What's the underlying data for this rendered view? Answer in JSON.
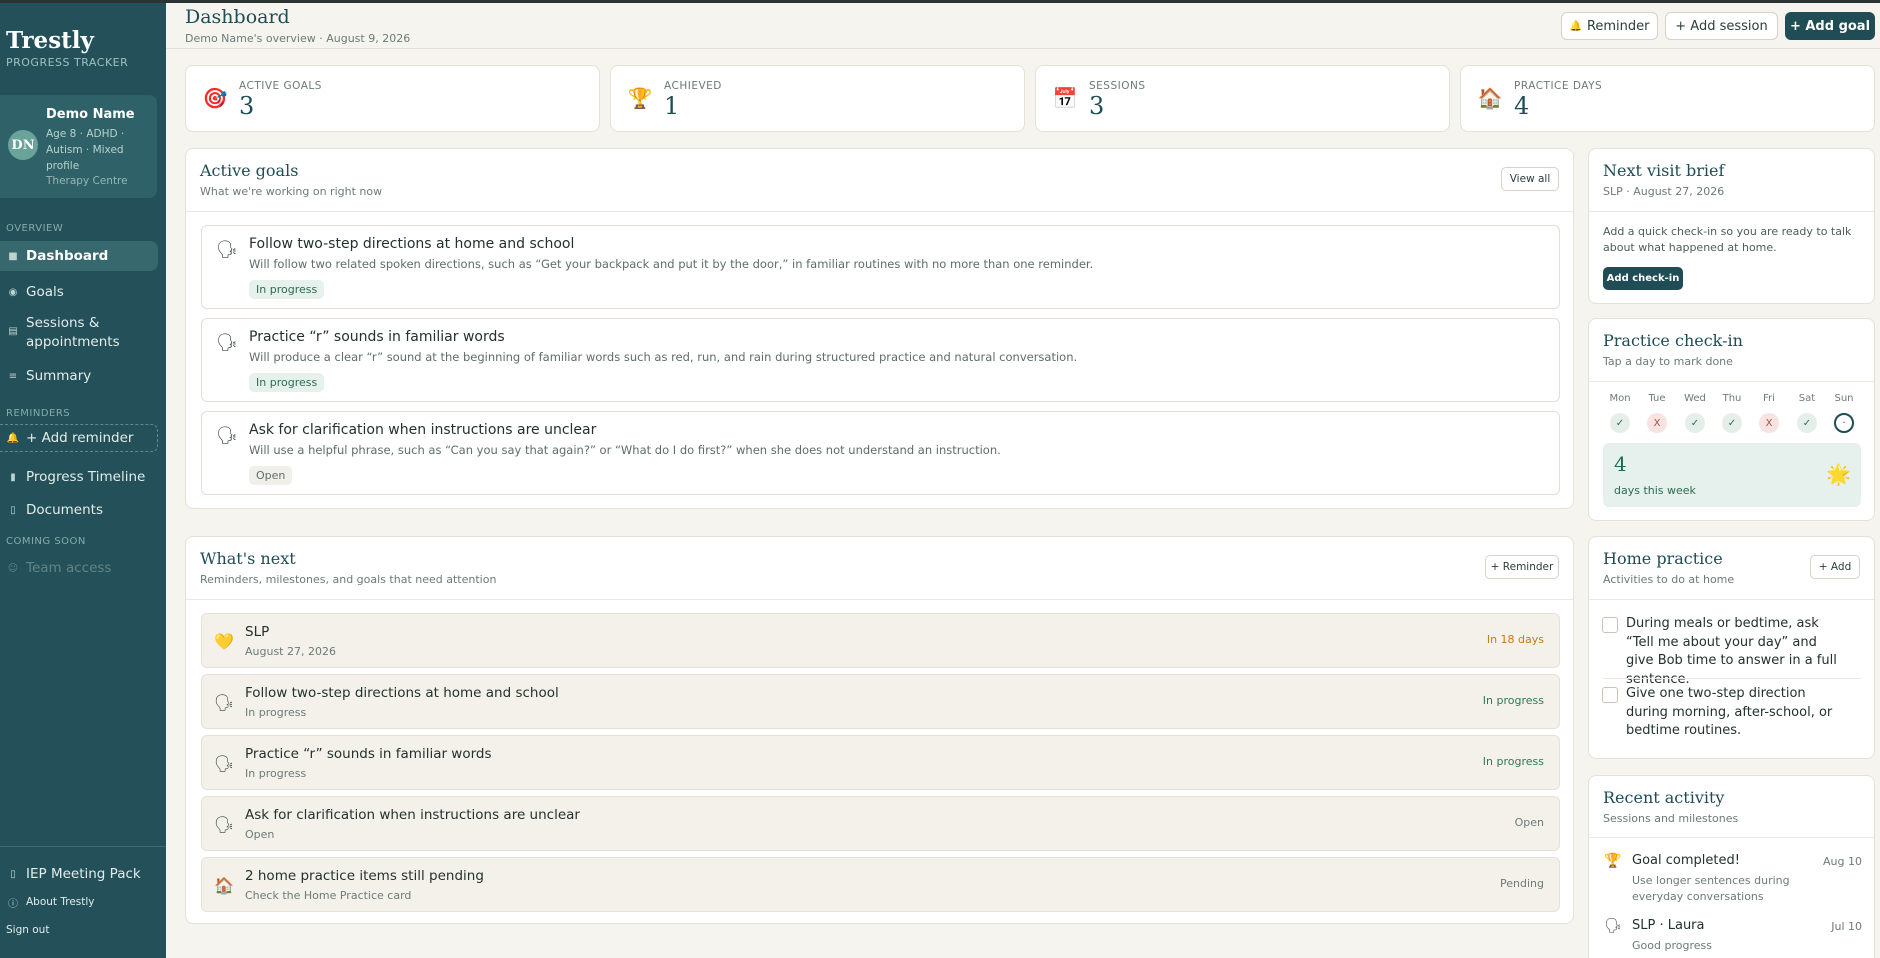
{
  "sidebar": {
    "brand": "Trestly",
    "brand_sub": "PROGRESS TRACKER",
    "profile": {
      "initials": "DN",
      "name": "Demo Name",
      "details": "Age 8 · ADHD · Autism · Mixed profile",
      "org": "Therapy Centre"
    },
    "overview_label": "OVERVIEW",
    "nav": [
      {
        "label": "Dashboard",
        "icon": "dashboard-icon"
      },
      {
        "label": "Goals",
        "icon": "target-icon"
      },
      {
        "label": "Sessions & appointments",
        "icon": "calendar-icon"
      },
      {
        "label": "Summary",
        "icon": "list-icon"
      }
    ],
    "reminders_label": "REMINDERS",
    "add_reminder": "+ Add reminder",
    "nav2": [
      {
        "label": "Progress Timeline",
        "icon": "chart-icon"
      },
      {
        "label": "Documents",
        "icon": "document-icon"
      }
    ],
    "coming_soon_label": "COMING SOON",
    "team_access": "Team access",
    "iep": "IEP Meeting Pack",
    "about": "About Trestly",
    "signout": "Sign out"
  },
  "header": {
    "title": "Dashboard",
    "subtitle": "Demo Name's overview · August 9, 2026",
    "reminder_btn": "Reminder",
    "add_session_btn": "+ Add session",
    "add_goal_btn": "+ Add goal"
  },
  "stats": [
    {
      "label": "ACTIVE GOALS",
      "value": "3",
      "icon": "target-icon"
    },
    {
      "label": "ACHIEVED",
      "value": "1",
      "icon": "trophy-icon"
    },
    {
      "label": "SESSIONS",
      "value": "3",
      "icon": "calendar-icon"
    },
    {
      "label": "PRACTICE DAYS",
      "value": "4",
      "icon": "house-icon"
    }
  ],
  "active_goals": {
    "title": "Active goals",
    "subtitle": "What we're working on right now",
    "view_all": "View all",
    "items": [
      {
        "title": "Follow two-step directions at home and school",
        "desc": "Will follow two related spoken directions, such as “Get your backpack and put it by the door,” in familiar routines with no more than one reminder.",
        "status": "In progress"
      },
      {
        "title": "Practice “r” sounds in familiar words",
        "desc": "Will produce a clear “r” sound at the beginning of familiar words such as red, run, and rain during structured practice and natural conversation.",
        "status": "In progress"
      },
      {
        "title": "Ask for clarification when instructions are unclear",
        "desc": "Will use a helpful phrase, such as “Can you say that again?” or “What do I do first?” when she does not understand an instruction.",
        "status": "Open"
      }
    ]
  },
  "whats_next": {
    "title": "What's next",
    "subtitle": "Reminders, milestones, and goals that need attention",
    "reminder_btn": "+ Reminder",
    "items": [
      {
        "title": "SLP",
        "sub": "August 27, 2026",
        "right": "In 18 days",
        "color": "#c77a1a",
        "icon": "heart-icon"
      },
      {
        "title": "Follow two-step directions at home and school",
        "sub": "In progress",
        "right": "In progress",
        "color": "#2e7a55",
        "icon": "speech-icon"
      },
      {
        "title": "Practice “r” sounds in familiar words",
        "sub": "In progress",
        "right": "In progress",
        "color": "#2e7a55",
        "icon": "speech-icon"
      },
      {
        "title": "Ask for clarification when instructions are unclear",
        "sub": "Open",
        "right": "Open",
        "color": "#6c7b78",
        "icon": "speech-icon"
      },
      {
        "title": "2 home practice items still pending",
        "sub": "Check the Home Practice card",
        "right": "Pending",
        "color": "#6c7b78",
        "icon": "house-icon"
      }
    ]
  },
  "next_visit": {
    "title": "Next visit brief",
    "subtitle": "SLP · August 27, 2026",
    "body": "Add a quick check-in so you are ready to talk about what happened at home.",
    "button": "Add check-in"
  },
  "practice": {
    "title": "Practice check-in",
    "subtitle": "Tap a day to mark done",
    "days": [
      {
        "label": "Mon",
        "mark": "✓",
        "state": "ok"
      },
      {
        "label": "Tue",
        "mark": "X",
        "state": "miss"
      },
      {
        "label": "Wed",
        "mark": "✓",
        "state": "ok"
      },
      {
        "label": "Thu",
        "mark": "✓",
        "state": "ok"
      },
      {
        "label": "Fri",
        "mark": "X",
        "state": "miss"
      },
      {
        "label": "Sat",
        "mark": "✓",
        "state": "ok"
      },
      {
        "label": "Sun",
        "mark": "·",
        "state": "today"
      }
    ],
    "count": "4",
    "count_label": "days this week"
  },
  "home_practice": {
    "title": "Home practice",
    "subtitle": "Activities to do at home",
    "add": "+ Add",
    "items": [
      "During meals or bedtime, ask “Tell me about your day” and give Bob time to answer in a full sentence.",
      "Give one two-step direction during morning, after-school, or bedtime routines."
    ]
  },
  "recent": {
    "title": "Recent activity",
    "subtitle": "Sessions and milestones",
    "items": [
      {
        "title": "Goal completed!",
        "date": "Aug 10",
        "sub": "Use longer sentences during everyday conversations",
        "icon": "trophy-icon"
      },
      {
        "title": "SLP · Laura",
        "date": "Jul 10",
        "sub": "Good progress",
        "icon": "speech-icon"
      }
    ]
  },
  "colors": {
    "sidebar": "#24505a",
    "accent": "#1f4c55",
    "progress": "#2e7a55",
    "due": "#c77a1a"
  }
}
